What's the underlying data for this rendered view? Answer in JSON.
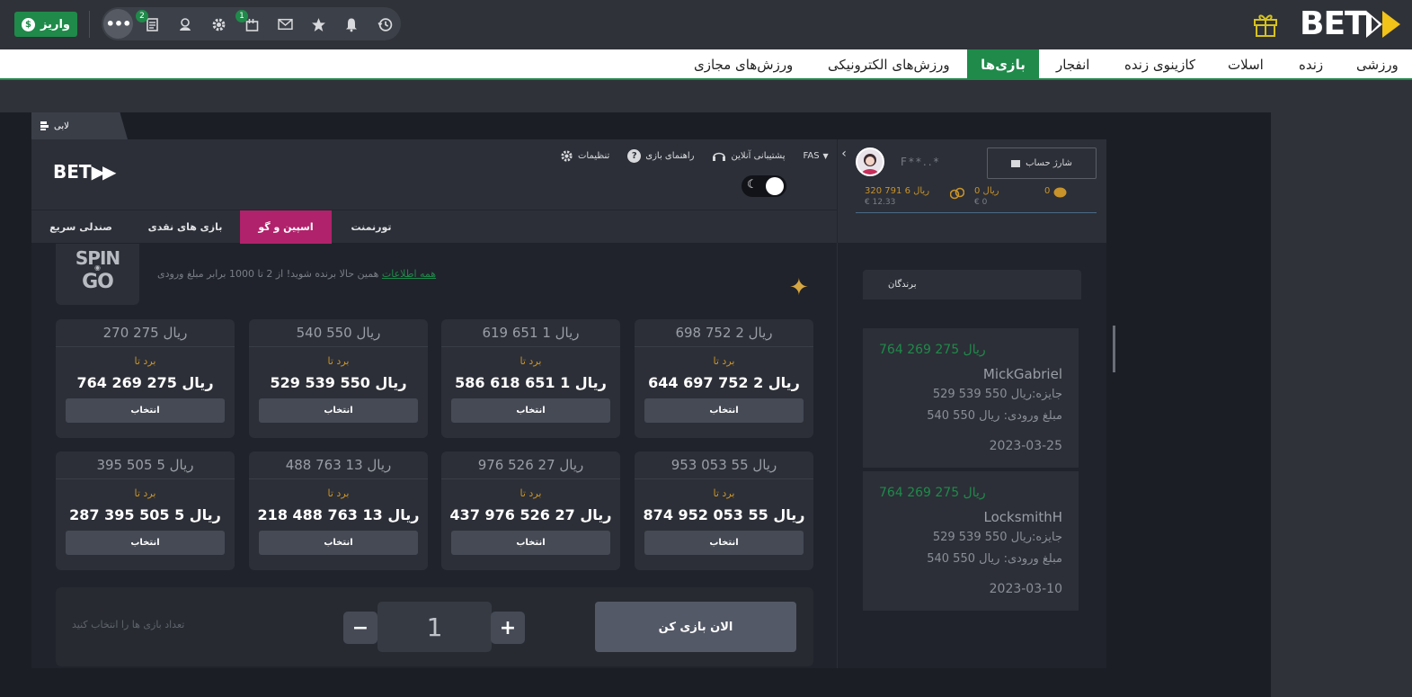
{
  "topbar": {
    "deposit_label": "واریز",
    "deposit_currency_symbol": "$",
    "badges": {
      "favorites_badge": "2",
      "bet_slip_badge": "1"
    },
    "brand": "BET"
  },
  "nav": {
    "items": [
      "ورزشی",
      "زنده",
      "اسلات",
      "کازینوی زنده",
      "انفجار",
      "بازی‌ها",
      "ورزش‌های الکترونیکی",
      "ورزش‌های مجازی"
    ],
    "active": "بازی‌ها"
  },
  "lobby": {
    "tab_label": "لابی",
    "logo": "BET",
    "links": {
      "settings": "تنظیمات",
      "rules": "راهنمای بازی",
      "support": "پشتیبانی آنلاین",
      "language": "FAS"
    },
    "tabs": [
      "تورنمنت",
      "اسپین و گو",
      "بازی های نقدی",
      "صندلی سریع"
    ],
    "active_tab": "اسپین و گو",
    "promo_text": "همین حالا برنده شوید! از 2 تا 1000 برابر مبلغ ورودی",
    "promo_link": "همه اطلاعات",
    "spin_logo_top": "SPIN",
    "spin_logo_bottom": "GO"
  },
  "account": {
    "charge_label": "شارژ حساب",
    "name_masked": "F**..*",
    "balances": [
      {
        "main": "ریال 6 791 320",
        "sub": "€ 12.33"
      },
      {
        "main": "ریال 0",
        "sub": "€ 0"
      },
      {
        "main": "0",
        "sub": ""
      }
    ]
  },
  "cards": [
    {
      "buyin": "ریال 2 752 698",
      "win_label": "برد تا",
      "prize": "ریال 2 752 697 644",
      "pick": "انتخاب"
    },
    {
      "buyin": "ریال 1 651 619",
      "win_label": "برد تا",
      "prize": "ریال 1 651 618 586",
      "pick": "انتخاب"
    },
    {
      "buyin": "ریال 550 540",
      "win_label": "برد تا",
      "prize": "ریال 550 539 529",
      "pick": "انتخاب"
    },
    {
      "buyin": "ریال 275 270",
      "win_label": "برد تا",
      "prize": "ریال 275 269 764",
      "pick": "انتخاب"
    },
    {
      "buyin": "ریال 55 053 953",
      "win_label": "برد تا",
      "prize": "ریال 55 053 952 874",
      "pick": "انتخاب"
    },
    {
      "buyin": "ریال 27 526 976",
      "win_label": "برد تا",
      "prize": "ریال 27 526 976 437",
      "pick": "انتخاب"
    },
    {
      "buyin": "ریال 13 763 488",
      "win_label": "برد تا",
      "prize": "ریال 13 763 488 218",
      "pick": "انتخاب"
    },
    {
      "buyin": "ریال 5 505 395",
      "win_label": "برد تا",
      "prize": "ریال 5 505 395 287",
      "pick": "انتخاب"
    }
  ],
  "controls": {
    "hint": "تعداد بازی ها را انتخاب کنید",
    "minus": "−",
    "plus": "+",
    "count": "1",
    "play_label": "الان بازی کن"
  },
  "winners": {
    "title": "برندگان",
    "entries": [
      {
        "amount": "ریال 275 269 764",
        "name": "MickGabriel",
        "prize": "جایزه:ریال 550 539 529",
        "entry": "مبلغ ورودی: ریال 550 540",
        "date": "2023-03-25"
      },
      {
        "amount": "ریال 275 269 764",
        "name": "LocksmithH",
        "prize": "جایزه:ریال 550 539 529",
        "entry": "مبلغ ورودی: ریال 550 540",
        "date": "2023-03-10"
      }
    ]
  },
  "colors": {
    "accent_green": "#1f8a4a",
    "accent_magenta": "#b0226b",
    "gold": "#c8932a"
  }
}
